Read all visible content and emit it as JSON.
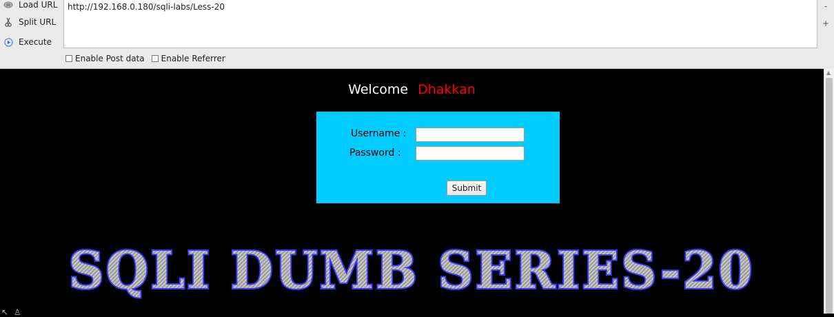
{
  "hackbar": {
    "actions": [
      {
        "label": "Load URL",
        "icon": "load-url-icon"
      },
      {
        "label": "Split URL",
        "icon": "split-url-icon"
      },
      {
        "label": "Execute",
        "icon": "execute-icon"
      }
    ],
    "url_value": "http://192.168.0.180/sqli-labs/Less-20",
    "side_minus": "-",
    "side_plus": "+",
    "checkboxes": [
      {
        "label": "Enable Post data",
        "checked": false
      },
      {
        "label": "Enable Referrer",
        "checked": false
      }
    ]
  },
  "page": {
    "welcome": "Welcome",
    "name": "Dhakkan",
    "username_label": "Username :",
    "password_label": "Password :",
    "username_value": "",
    "password_value": "",
    "submit_label": "Submit",
    "banner_text": "SQLI DUMB SERIES-20"
  },
  "colors": {
    "page_background": "#000000",
    "name_color": "#ff0000",
    "login_box": "#00ccff",
    "banner_outline": "#3a3aff"
  }
}
